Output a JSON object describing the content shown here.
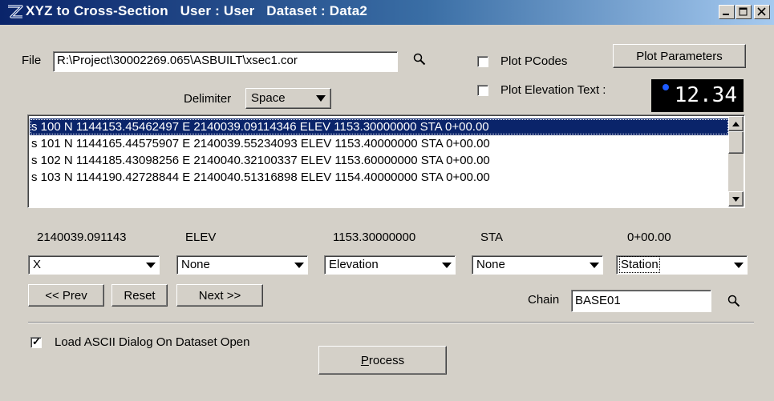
{
  "window": {
    "title": "XYZ to Cross-Section   User : User   Dataset : Data2",
    "minimize_label": "_",
    "maximize_label": "□",
    "close_label": "✕"
  },
  "file": {
    "label": "File",
    "path": "R:\\Project\\30002269.065\\ASBUILT\\xsec1.cor"
  },
  "delimiter": {
    "label": "Delimiter",
    "value": "Space"
  },
  "options": {
    "plot_pcodes_label": "Plot PCodes",
    "plot_pcodes_checked": false,
    "plot_elev_text_label": "Plot Elevation Text :",
    "plot_elev_text_checked": false,
    "plot_parameters_label": "Plot Parameters",
    "elev_text_preview": "12.34"
  },
  "list": {
    "rows": [
      "s 100 N 1144153.45462497 E 2140039.09114346 ELEV 1153.30000000  STA 0+00.00",
      "s 101 N 1144165.44575907 E 2140039.55234093 ELEV 1153.40000000  STA 0+00.00",
      "s 102 N 1144185.43098256 E 2140040.32100337 ELEV 1153.60000000  STA 0+00.00",
      "s 103 N 1144190.42728844 E 2140040.51316898 ELEV 1154.40000000  STA 0+00.00"
    ],
    "selected_index": 0
  },
  "fields": {
    "tokens": [
      "2140039.091143",
      "ELEV",
      "1153.30000000",
      "STA",
      "0+00.00"
    ],
    "assignments": [
      "X",
      "None",
      "Elevation",
      "None",
      "Station"
    ]
  },
  "nav": {
    "prev_label": "<< Prev",
    "reset_label": "Reset",
    "next_label": "Next >>"
  },
  "chain": {
    "label": "Chain",
    "value": "BASE01"
  },
  "footer": {
    "load_ascii_label": "Load ASCII Dialog On Dataset Open",
    "load_ascii_checked": true,
    "process_label_underlined": "P",
    "process_label_rest": "rocess"
  },
  "colors": {
    "title_start": "#0a246a",
    "title_end": "#a6caf0",
    "selection": "#0a246a",
    "face": "#d4d0c8"
  }
}
